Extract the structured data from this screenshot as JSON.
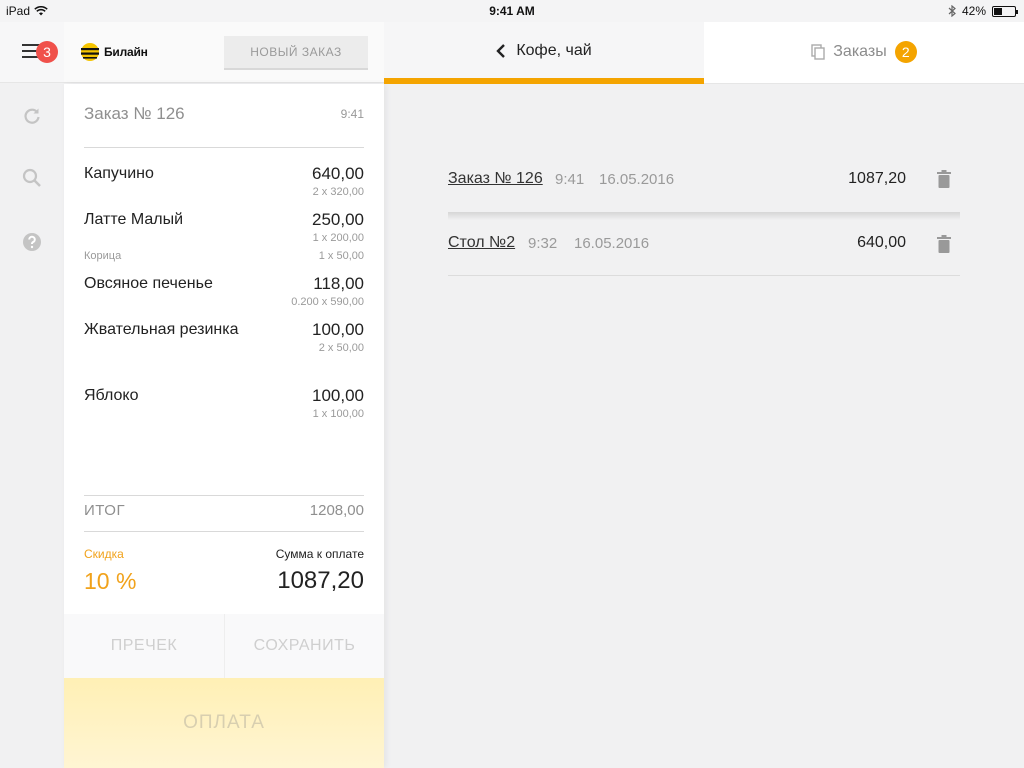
{
  "status_bar": {
    "device": "iPad",
    "time": "9:41 AM",
    "battery": "42%",
    "battery_level": 0.42
  },
  "rail": {
    "menu_badge": "3"
  },
  "header": {
    "logo_text": "Билайн",
    "new_order_label": "НОВЫЙ ЗАКАЗ"
  },
  "order": {
    "title": "Заказ № 126",
    "time": "9:41",
    "items": [
      {
        "name": "Капучино",
        "price": "640,00",
        "qty": "2 x 320,00"
      },
      {
        "name": "Латте Малый",
        "price": "250,00",
        "qty": "1 x 200,00",
        "modifier": "Корица",
        "modifier_qty": "1 x 50,00"
      },
      {
        "name": "Овсяное печенье",
        "price": "118,00",
        "qty": "0.200 x 590,00"
      },
      {
        "name": "Жвательная резинка",
        "price": "100,00",
        "qty": "2 x 50,00"
      },
      {
        "name": "Яблоко",
        "price": "100,00",
        "qty": "1 x 100,00"
      }
    ],
    "total_label": "ИТОГ",
    "total_value": "1208,00",
    "discount_label": "Скидка",
    "discount_value": "10 %",
    "to_pay_label": "Сумма к оплате",
    "to_pay_value": "1087,20",
    "precheck_label": "ПРЕЧЕК",
    "save_label": "СОХРАНИТЬ",
    "pay_label": "ОПЛАТА"
  },
  "tabs": {
    "back_label": "Кофе, чай",
    "orders_label": "Заказы",
    "orders_badge": "2"
  },
  "orders_list": [
    {
      "name": "Заказ № 126",
      "time": "9:41",
      "date": "16.05.2016",
      "amount": "1087,20"
    },
    {
      "name": "Стол №2",
      "time": "9:32",
      "date": "16.05.2016",
      "amount": "640,00"
    }
  ],
  "colors": {
    "accent": "#f4a400",
    "badge_red": "#f0514b",
    "discount": "#f1a21b",
    "pay_button": "#fff0b5"
  }
}
